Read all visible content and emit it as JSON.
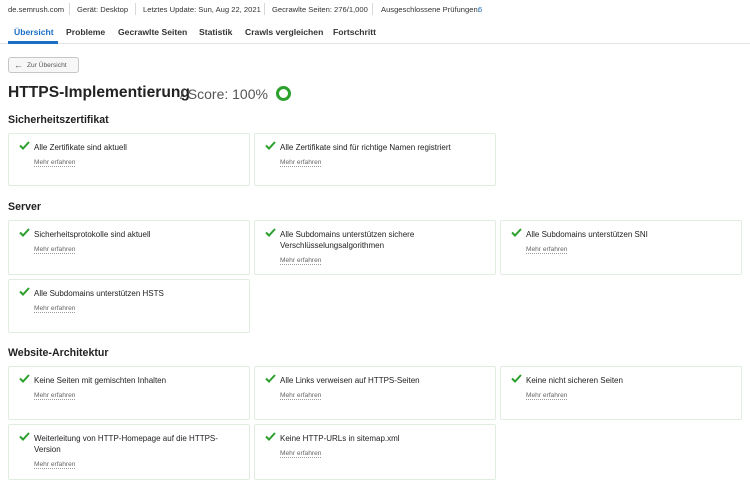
{
  "topbar": {
    "domain": "de.semrush.com",
    "device": "Gerät: Desktop",
    "last_update": "Letztes Update: Sun, Aug 22, 2021",
    "crawled_pages": "Gecrawlte Seiten: 276/1,000",
    "checks_label": "Ausgeschlossene Prüfungen:",
    "checks_count": "6"
  },
  "tabs": [
    "Übersicht",
    "Probleme",
    "Gecrawlte Seiten",
    "Statistik",
    "Crawls vergleichen",
    "Fortschritt"
  ],
  "active_tab": "Übersicht",
  "back_button": {
    "label": "Zur Übersicht",
    "icon": "arrow-left-icon"
  },
  "title": "HTTPS-Implementierung",
  "score_text": "/ Score: 100%",
  "score_value": 1.0,
  "status_color": "#2ca02c",
  "accent_color": "#1a6ec5",
  "more_label": "Mehr erfahren",
  "sections": [
    {
      "title": "Sicherheitszertifikat",
      "items": [
        "Alle Zertifikate sind aktuell",
        "Alle Zertifikate sind für richtige Namen registriert"
      ]
    },
    {
      "title": "Server",
      "items": [
        "Sicherheitsprotokolle sind aktuell",
        "Alle Subdomains unterstützen sichere Verschlüsselungsalgorithmen",
        "Alle Subdomains unterstützen SNI",
        "Alle Subdomains unterstützen HSTS"
      ]
    },
    {
      "title": "Website-Architektur",
      "items": [
        "Keine Seiten mit gemischten Inhalten",
        "Alle Links verweisen auf HTTPS-Seiten",
        "Keine nicht sicheren Seiten",
        "Weiterleitung von HTTP-Homepage auf die HTTPS-Version",
        "Keine HTTP-URLs in sitemap.xml"
      ]
    }
  ]
}
